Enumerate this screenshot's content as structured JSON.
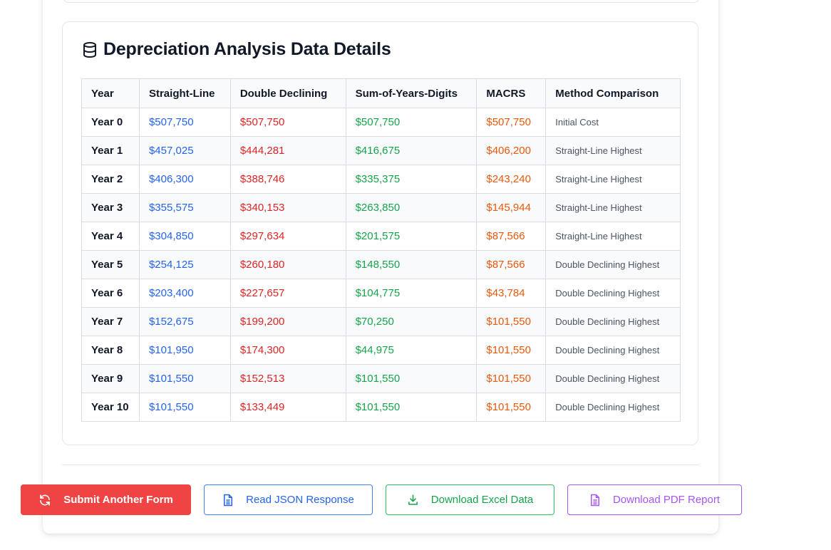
{
  "section": {
    "title": "Depreciation Analysis Data Details",
    "icon": "database-icon"
  },
  "table": {
    "headers": [
      "Year",
      "Straight-Line",
      "Double Declining",
      "Sum-of-Years-Digits",
      "MACRS",
      "Method Comparison"
    ],
    "rows": [
      [
        "Year 0",
        "$507,750",
        "$507,750",
        "$507,750",
        "$507,750",
        "Initial Cost"
      ],
      [
        "Year 1",
        "$457,025",
        "$444,281",
        "$416,675",
        "$406,200",
        "Straight-Line Highest"
      ],
      [
        "Year 2",
        "$406,300",
        "$388,746",
        "$335,375",
        "$243,240",
        "Straight-Line Highest"
      ],
      [
        "Year 3",
        "$355,575",
        "$340,153",
        "$263,850",
        "$145,944",
        "Straight-Line Highest"
      ],
      [
        "Year 4",
        "$304,850",
        "$297,634",
        "$201,575",
        "$87,566",
        "Straight-Line Highest"
      ],
      [
        "Year 5",
        "$254,125",
        "$260,180",
        "$148,550",
        "$87,566",
        "Double Declining Highest"
      ],
      [
        "Year 6",
        "$203,400",
        "$227,657",
        "$104,775",
        "$43,784",
        "Double Declining Highest"
      ],
      [
        "Year 7",
        "$152,675",
        "$199,200",
        "$70,250",
        "$101,550",
        "Double Declining Highest"
      ],
      [
        "Year 8",
        "$101,950",
        "$174,300",
        "$44,975",
        "$101,550",
        "Double Declining Highest"
      ],
      [
        "Year 9",
        "$101,550",
        "$152,513",
        "$101,550",
        "$101,550",
        "Double Declining Highest"
      ],
      [
        "Year 10",
        "$101,550",
        "$133,449",
        "$101,550",
        "$101,550",
        "Double Declining Highest"
      ]
    ]
  },
  "buttons": {
    "submit": {
      "label": "Submit Another Form",
      "icon": "refresh-icon"
    },
    "json": {
      "label": "Read JSON Response",
      "icon": "file-icon"
    },
    "excel": {
      "label": "Download Excel Data",
      "icon": "download-icon"
    },
    "pdf": {
      "label": "Download PDF Report",
      "icon": "file-icon"
    }
  },
  "colors": {
    "straight_line": "#2563eb",
    "double_declining": "#dc2626",
    "sum_of_years": "#16a34a",
    "macrs": "#ea580c",
    "submit_bg": "#ef4444",
    "pdf_accent": "#a855f7"
  }
}
